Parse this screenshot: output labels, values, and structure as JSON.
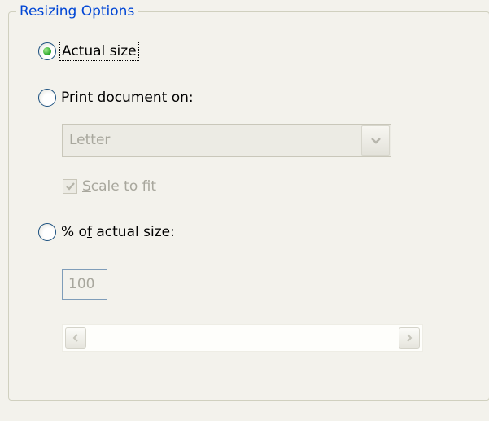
{
  "group": {
    "title": "Resizing Options"
  },
  "options": {
    "actual_size": {
      "label": "Actual size",
      "selected": true
    },
    "print_on": {
      "label_pre": "Print ",
      "label_ul": "d",
      "label_post": "ocument on:",
      "selected": false
    },
    "paper_select": {
      "value": "Letter",
      "enabled": false
    },
    "scale_to_fit": {
      "label_ul": "S",
      "label_post": "cale to fit",
      "checked": true,
      "enabled": false
    },
    "percent": {
      "label_pre": "% o",
      "label_ul": "f",
      "label_post": " actual size:",
      "selected": false
    },
    "percent_value": {
      "value": "100",
      "enabled": false
    }
  },
  "icons": {
    "combo_arrow": "chevron-down-icon",
    "scroll_left": "chevron-left-icon",
    "scroll_right": "chevron-right-icon",
    "check": "checkmark-icon"
  },
  "colors": {
    "legend": "#0046d5",
    "radio_selected": "#21a121",
    "disabled_text": "#a8a79d"
  }
}
